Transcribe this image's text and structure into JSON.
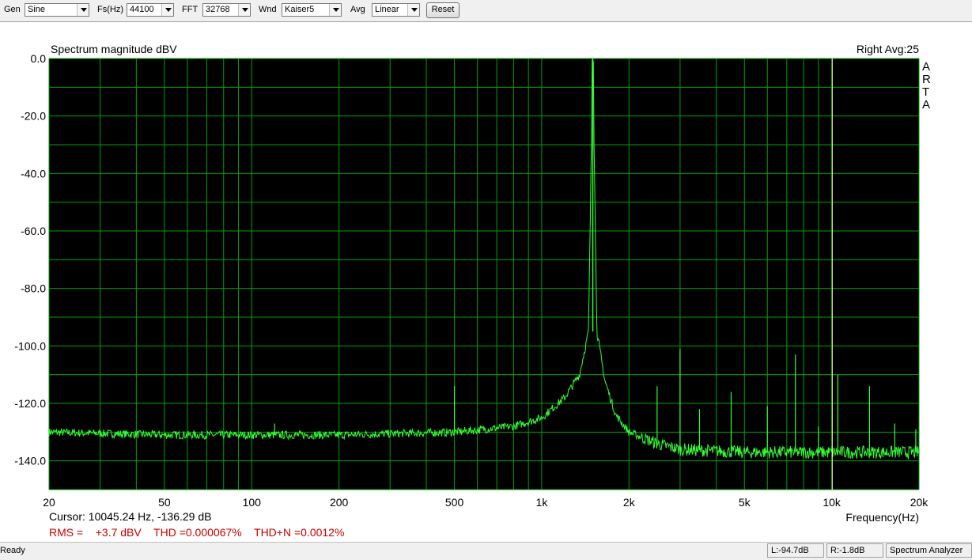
{
  "toolbar": {
    "gen_label": "Gen",
    "gen_value": "Sine",
    "fs_label": "Fs(Hz)",
    "fs_value": "44100",
    "fft_label": "FFT",
    "fft_value": "32768",
    "wnd_label": "Wnd",
    "wnd_value": "Kaiser5",
    "avg_label": "Avg",
    "avg_value": "Linear",
    "reset_label": "Reset"
  },
  "plot": {
    "title": "Spectrum magnitude dBV",
    "channel_info": "Right  Avg:25",
    "side_logo": [
      "A",
      "R",
      "T",
      "A"
    ],
    "cursor_text": "Cursor: 10045.24 Hz, -136.29 dB",
    "measure_text": "RMS =    +3.7 dBV    THD =0.000067%    THD+N =0.0012%",
    "colors": {
      "background": "#000000",
      "grid": "#00a000",
      "trace": "#33ff33",
      "cursor": "#ffff99",
      "measure": "#cc0000"
    }
  },
  "chart_data": {
    "type": "line",
    "title": "Spectrum magnitude dBV",
    "xlabel": "Frequency(Hz)",
    "ylabel": "",
    "xscale": "log",
    "xlim": [
      20,
      20000
    ],
    "ylim": [
      -150,
      0
    ],
    "x_ticks": [
      20,
      50,
      100,
      200,
      500,
      1000,
      2000,
      5000,
      10000,
      20000
    ],
    "x_tick_labels": [
      "20",
      "50",
      "100",
      "200",
      "500",
      "1k",
      "2k",
      "5k",
      "10k",
      "20k"
    ],
    "y_ticks": [
      0,
      -20,
      -40,
      -60,
      -80,
      -100,
      -120,
      -140
    ],
    "y_tick_labels": [
      "0.0",
      "-20.0",
      "-40.0",
      "-60.0",
      "-80.0",
      "-100.0",
      "-120.0",
      "-140.0"
    ],
    "grid": true,
    "cursor_freq": 10045.24,
    "fundamental": {
      "freq": 1500,
      "level": 0
    },
    "noise_floor": [
      [
        20,
        -130
      ],
      [
        50,
        -131
      ],
      [
        100,
        -131
      ],
      [
        200,
        -131
      ],
      [
        500,
        -130
      ],
      [
        800,
        -128
      ],
      [
        1000,
        -125
      ],
      [
        1200,
        -118
      ],
      [
        1350,
        -110
      ],
      [
        1450,
        -95
      ],
      [
        1500,
        0
      ],
      [
        1550,
        -95
      ],
      [
        1650,
        -112
      ],
      [
        1800,
        -124
      ],
      [
        2000,
        -130
      ],
      [
        2500,
        -134
      ],
      [
        3000,
        -136
      ],
      [
        5000,
        -137
      ],
      [
        10000,
        -137
      ],
      [
        20000,
        -137
      ]
    ],
    "spurs": [
      {
        "freq": 120,
        "level": -127
      },
      {
        "freq": 500,
        "level": -114
      },
      {
        "freq": 2500,
        "level": -114
      },
      {
        "freq": 3000,
        "level": -101
      },
      {
        "freq": 3500,
        "level": -122
      },
      {
        "freq": 4500,
        "level": -116
      },
      {
        "freq": 6000,
        "level": -121
      },
      {
        "freq": 7500,
        "level": -103
      },
      {
        "freq": 9000,
        "level": -128
      },
      {
        "freq": 10500,
        "level": -110
      },
      {
        "freq": 13500,
        "level": -114
      },
      {
        "freq": 16500,
        "level": -127
      },
      {
        "freq": 19500,
        "level": -129
      }
    ]
  },
  "status": {
    "ready": "Ready",
    "left_level": "L:-94.7dB",
    "right_level": "R:-1.8dB",
    "mode": "Spectrum Analyzer"
  }
}
